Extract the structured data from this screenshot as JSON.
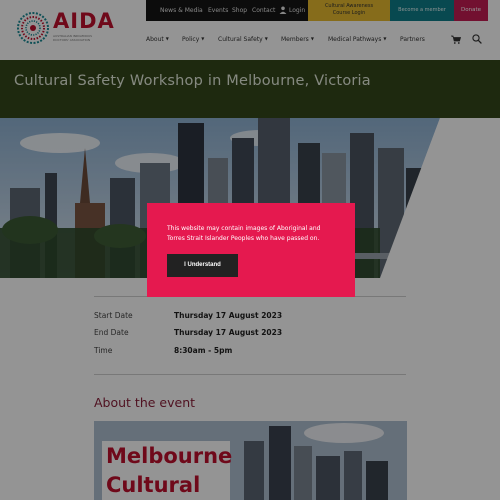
{
  "logo": {
    "wordmark": "AIDA",
    "subtitle": "AUSTRALIAN INDIGENOUS DOCTORS' ASSOCIATION",
    "icon": "aida-logo-icon"
  },
  "topbar": {
    "links": [
      "News & Media",
      "Events",
      "Shop",
      "Contact"
    ],
    "login_label": "Login",
    "cultural_label_line1": "Cultural Awareness",
    "cultural_label_line2": "Course Login",
    "become_label": "Become a member",
    "donate_label": "Donate"
  },
  "mainnav": {
    "items": [
      "About",
      "Policy",
      "Cultural Safety",
      "Members",
      "Medical Pathways",
      "Partners"
    ]
  },
  "page": {
    "title": "Cultural Safety Workshop in Melbourne, Victoria"
  },
  "event_details": {
    "rows": [
      {
        "label": "Start Date",
        "value": "Thursday 17 August 2023"
      },
      {
        "label": "End Date",
        "value": "Thursday 17 August 2023"
      },
      {
        "label": "Time",
        "value": "8:30am - 5pm"
      }
    ]
  },
  "about": {
    "heading": "About the event",
    "image_text_line1": "Melbourne",
    "image_text_line2": "Cultural"
  },
  "modal": {
    "message": "This website may contain images of Aboriginal and Torres Strait Islander Peoples who have passed on.",
    "button_label": "I Understand"
  },
  "colors": {
    "brand_red": "#c0112e",
    "title_band": "#34471b",
    "modal_bg": "#e5194f",
    "cultural_yellow": "#e7bb2f",
    "become_teal": "#0f7f8a",
    "donate_pink": "#c41c53",
    "about_heading": "#8a1f3a"
  }
}
